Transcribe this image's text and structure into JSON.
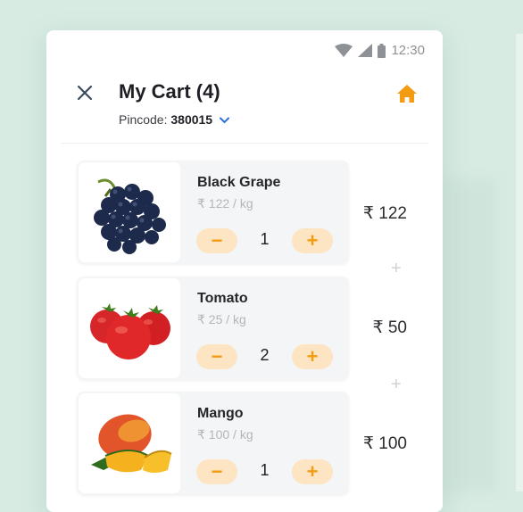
{
  "status_bar": {
    "time": "12:30"
  },
  "header": {
    "title": "My Cart (4)",
    "pincode_label": "Pincode:",
    "pincode_value": "380015"
  },
  "colors": {
    "accent": "#f39c12",
    "accent_soft": "#fde4c2",
    "background": "#d7ebe2"
  },
  "icons": [
    "wifi-icon",
    "signal-icon",
    "battery-icon",
    "close-icon",
    "chevron-down-icon",
    "home-icon"
  ],
  "cart_items": [
    {
      "name": "Black Grape",
      "unit_price": "₹ 122 / kg",
      "quantity": "1",
      "total": "₹ 122",
      "minus": "−",
      "plus": "+"
    },
    {
      "name": "Tomato",
      "unit_price": "₹ 25 / kg",
      "quantity": "2",
      "total": "₹ 50",
      "minus": "−",
      "plus": "+"
    },
    {
      "name": "Mango",
      "unit_price": "₹ 100 / kg",
      "quantity": "1",
      "total": "₹ 100",
      "minus": "−",
      "plus": "+"
    }
  ],
  "separator_symbol": "+"
}
